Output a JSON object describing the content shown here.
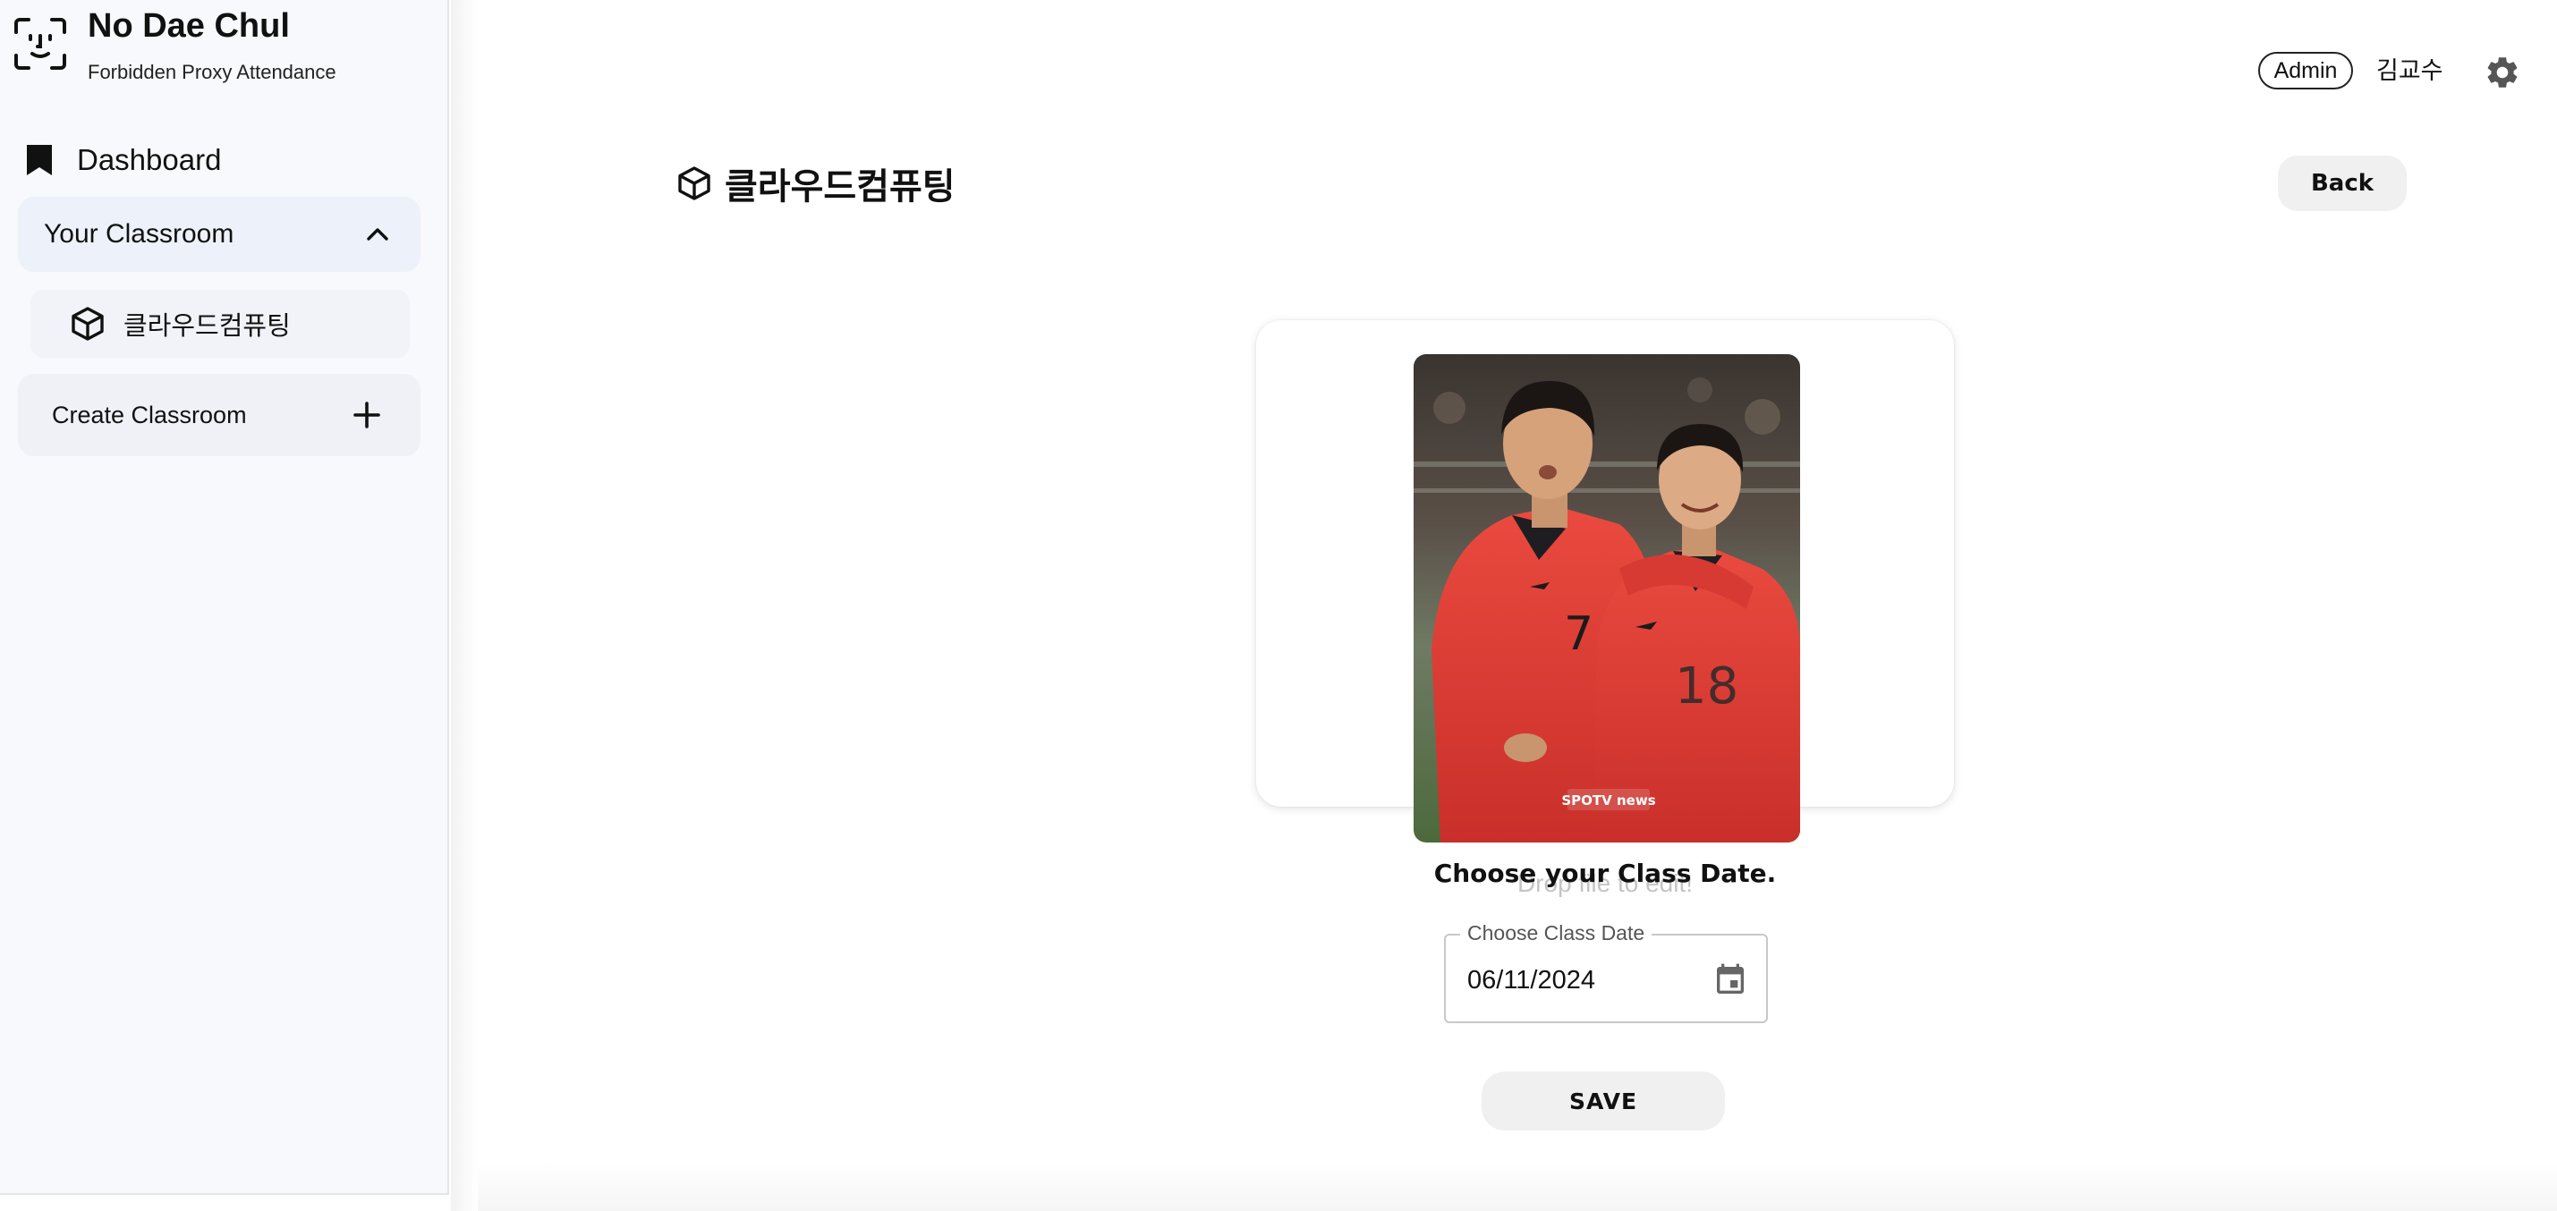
{
  "app": {
    "title": "No Dae Chul",
    "subtitle": "Forbidden Proxy Attendance",
    "logo_icon": "face-scan-icon"
  },
  "sidebar": {
    "dashboard": {
      "label": "Dashboard",
      "icon": "bookmark-icon"
    },
    "classroom_group": {
      "label": "Your Classroom",
      "expanded": true,
      "icon": "chevron-up-icon"
    },
    "classrooms": [
      {
        "label": "클라우드컴퓨팅",
        "icon": "cube-icon"
      }
    ],
    "create": {
      "label": "Create Classroom",
      "icon": "plus-icon"
    }
  },
  "header": {
    "role_badge": "Admin",
    "user_name": "김교수",
    "settings_icon": "gear-icon"
  },
  "page": {
    "title": "클라우드컴퓨팅",
    "title_icon": "cube-icon",
    "back_label": "Back"
  },
  "upload": {
    "drop_hint": "Drop file to edit!",
    "photo_caption": "SPOTV news"
  },
  "form": {
    "heading": "Choose your Class Date.",
    "date_label": "Choose Class Date",
    "date_value": "06/11/2024",
    "calendar_icon": "calendar-icon",
    "save_label": "SAVE"
  },
  "colors": {
    "sidebar_bg": "#f8f9fc",
    "group_bg": "#edf1f9",
    "button_bg": "#f0f0f0",
    "jersey_red": "#e53a34"
  }
}
